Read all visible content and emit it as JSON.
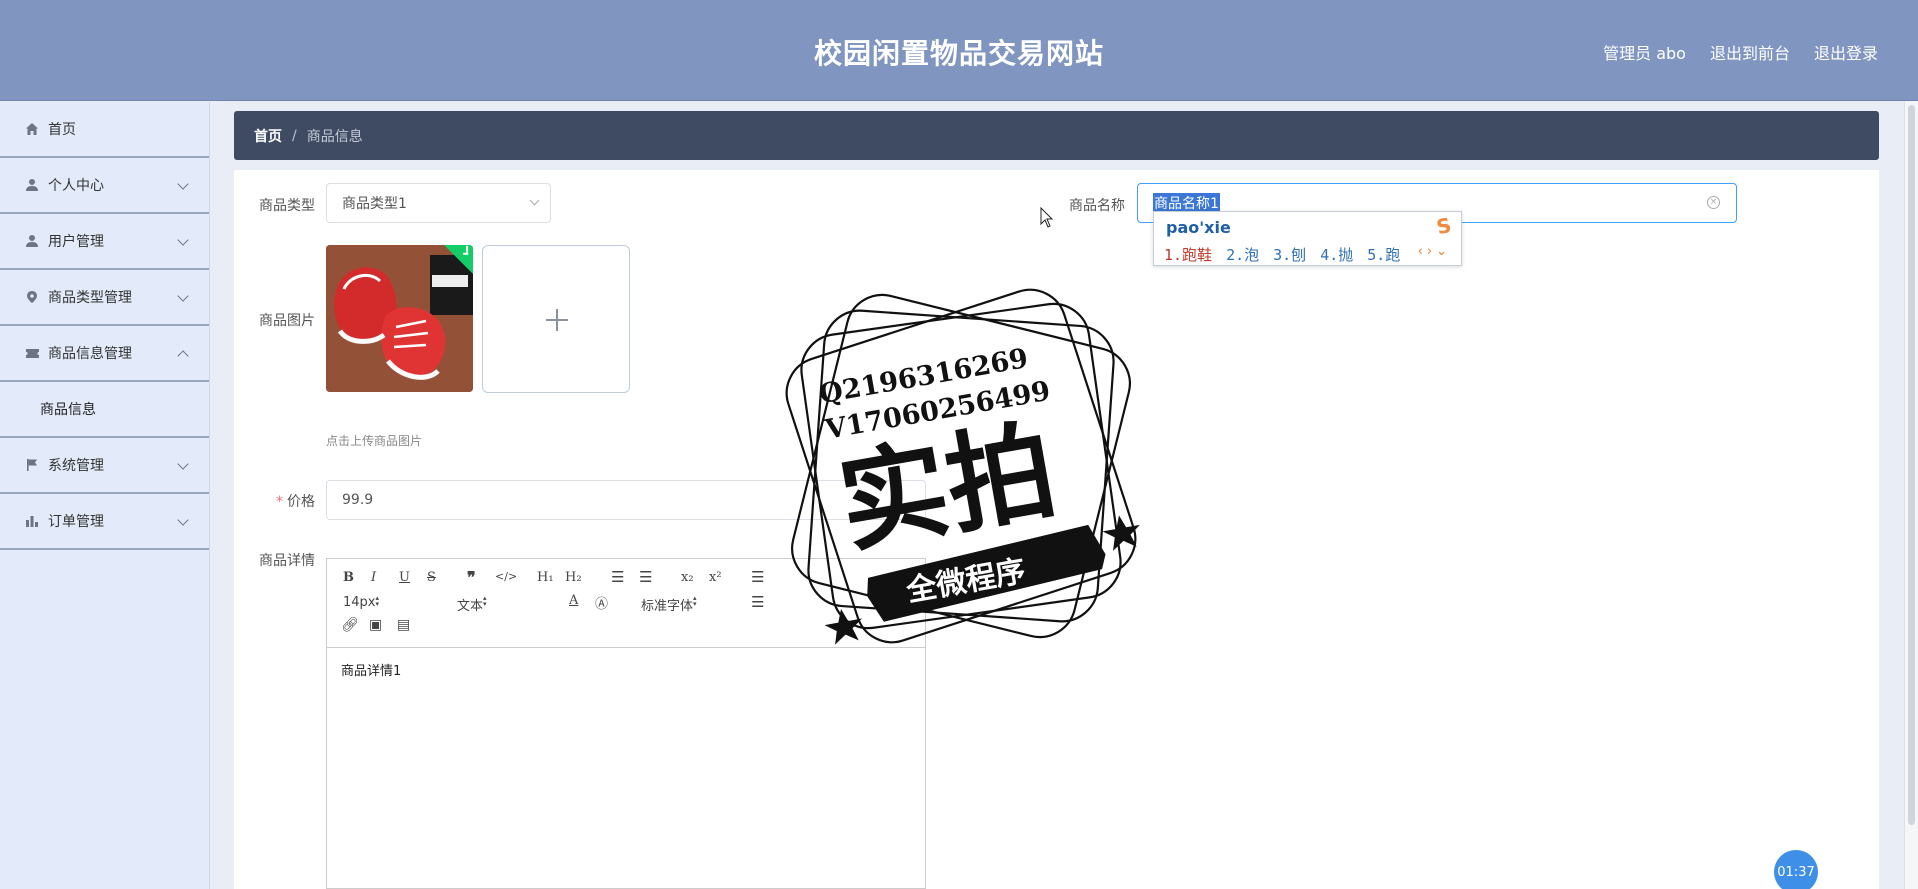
{
  "header": {
    "title": "校园闲置物品交易网站",
    "admin": "管理员 abo",
    "to_front": "退出到前台",
    "logout": "退出登录",
    "bg_color": "#8096c1"
  },
  "sidebar": {
    "items": [
      {
        "label": "首页",
        "icon": "home-icon"
      },
      {
        "label": "个人中心",
        "icon": "person-icon"
      },
      {
        "label": "用户管理",
        "icon": "person-icon"
      },
      {
        "label": "商品类型管理",
        "icon": "location-pin-icon"
      },
      {
        "label": "商品信息管理",
        "icon": "ticket-icon"
      },
      {
        "label": "商品信息",
        "icon": ""
      },
      {
        "label": "系统管理",
        "icon": "flag-icon"
      },
      {
        "label": "订单管理",
        "icon": "bar-chart-icon"
      }
    ]
  },
  "breadcrumb": {
    "home": "首页",
    "separator": "/",
    "current": "商品信息"
  },
  "form": {
    "type_label": "商品类型",
    "type_value": "商品类型1",
    "name_label": "商品名称",
    "name_value": "商品名称1",
    "image_label": "商品图片",
    "image_hint": "点击上传商品图片",
    "price_required": "*",
    "price_label": "价格",
    "price_value": "99.9",
    "detail_label": "商品详情",
    "detail_value": "商品详情1"
  },
  "ime": {
    "input": "pao'xie",
    "candidates": [
      "1.跑鞋",
      "2.泡",
      "3.刨",
      "4.抛",
      "5.跑"
    ],
    "logo": "S"
  },
  "editor": {
    "font_size": "14px",
    "block_type": "文本",
    "font_family": "标准字体"
  },
  "stamp": {
    "line1": "Q2196316269",
    "line2": "V17060256499",
    "main": "实拍",
    "banner": "全微程序"
  },
  "timer": "01:37"
}
